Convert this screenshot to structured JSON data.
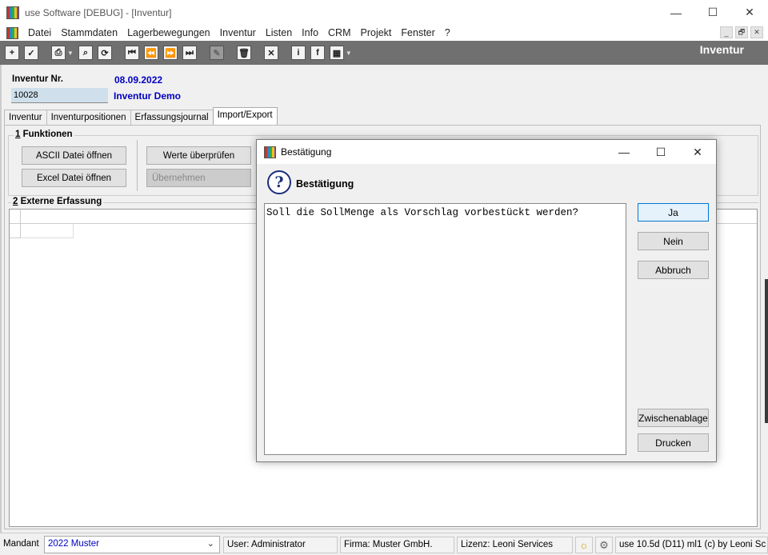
{
  "window": {
    "title": "use Software [DEBUG] - [Inventur]",
    "minimize": "—",
    "maximize": "☐",
    "close": "✕"
  },
  "menu": {
    "items": [
      "Datei",
      "Stammdaten",
      "Lagerbewegungen",
      "Inventur",
      "Listen",
      "Info",
      "CRM",
      "Projekt",
      "Fenster",
      "?"
    ],
    "mdi_controls": [
      "_",
      "🗗",
      "✕"
    ]
  },
  "toolbar": {
    "module_title": "Inventur",
    "buttons": [
      {
        "name": "add",
        "glyph": "+"
      },
      {
        "name": "confirm",
        "glyph": "✓"
      },
      {
        "name": "print",
        "glyph": "⎙"
      },
      {
        "name": "search",
        "glyph": "⌕"
      },
      {
        "name": "refresh",
        "glyph": "⟳"
      },
      {
        "name": "first",
        "glyph": "⏮"
      },
      {
        "name": "previous",
        "glyph": "⏪"
      },
      {
        "name": "next",
        "glyph": "⏩"
      },
      {
        "name": "last",
        "glyph": "⏭"
      },
      {
        "name": "edit",
        "glyph": "✎"
      },
      {
        "name": "delete",
        "glyph": "🗑"
      },
      {
        "name": "cancel",
        "glyph": "✕"
      },
      {
        "name": "info",
        "glyph": "i"
      },
      {
        "name": "facebook",
        "glyph": "f"
      },
      {
        "name": "grid",
        "glyph": "▦"
      }
    ]
  },
  "form": {
    "nr_label": "Inventur Nr.",
    "nr_value": "10028",
    "date": "08.09.2022",
    "name": "Inventur Demo"
  },
  "tabs": [
    "Inventur",
    "Inventurpositionen",
    "Erfassungsjournal",
    "Import/Export"
  ],
  "funktionen": {
    "title_num": "1",
    "title": " Funktionen",
    "ascii_button": "ASCII Datei öffnen",
    "excel_button": "Excel Datei öffnen",
    "check_button": "Werte überprüfen",
    "apply_button": "Übernehmen"
  },
  "externe": {
    "title_num": "2",
    "title": " Externe Erfassung"
  },
  "dialog": {
    "title": "Bestätigung",
    "heading": "Bestätigung",
    "message": "Soll die SollMenge als Vorschlag vorbestückt werden?",
    "yes": "Ja",
    "no": "Nein",
    "abort": "Abbruch",
    "clipboard": "Zwischenablage",
    "print": "Drucken"
  },
  "statusbar": {
    "mandant_label": "Mandant",
    "mandant_value": "2022 Muster",
    "user": "User: Administrator",
    "firma": "Firma: Muster GmbH.",
    "lizenz": "Lizenz: Leoni Services",
    "version": "use 10.5d (D11) ml1 (c) by Leoni Sc"
  }
}
